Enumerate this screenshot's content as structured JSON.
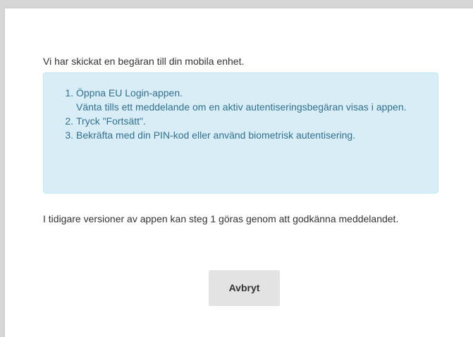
{
  "intro_text": "Vi har skickat en begäran till din mobila enhet.",
  "steps": [
    {
      "number": "1.",
      "text": "Öppna EU Login-appen.",
      "subtext": "Vänta tills ett meddelande om en aktiv autentiseringsbegäran visas i appen."
    },
    {
      "number": "2.",
      "text": "Tryck \"Fortsätt\".",
      "subtext": ""
    },
    {
      "number": "3.",
      "text": "Bekräfta med din PIN-kod eller använd biometrisk autentisering.",
      "subtext": ""
    }
  ],
  "note_text": "I tidigare versioner av appen kan steg 1 göras genom att godkänna meddelandet.",
  "cancel_label": "Avbryt",
  "colors": {
    "info_background": "#d9edf7",
    "info_border": "#bce8f1",
    "info_text": "#31708f",
    "button_background": "#e3e3e3"
  }
}
